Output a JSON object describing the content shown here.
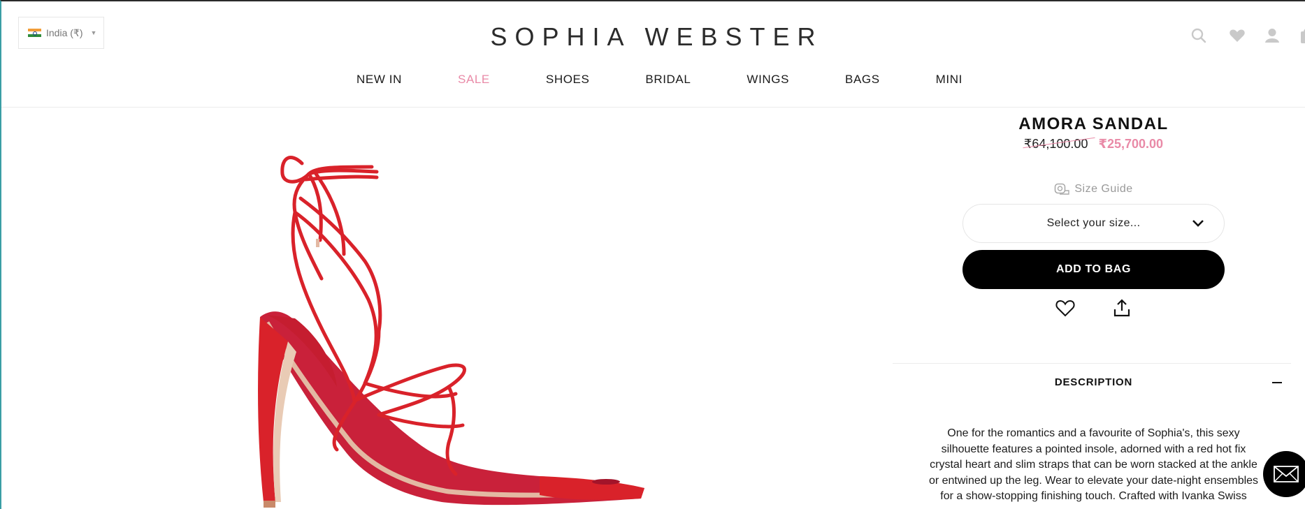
{
  "header": {
    "country": "India (₹)",
    "logo": "SOPHIA WEBSTER",
    "icons": [
      "search-icon",
      "heart-icon",
      "user-icon",
      "bag-icon"
    ]
  },
  "nav": {
    "items": [
      "NEW IN",
      "SALE",
      "SHOES",
      "BRIDAL",
      "WINGS",
      "BAGS",
      "MINI"
    ],
    "highlight_color": "#e98aa7"
  },
  "product": {
    "title": "AMORA SANDAL",
    "old_price": "₹64,100.00",
    "sale_price": "₹25,700.00",
    "size_guide": "Size Guide",
    "size_placeholder": "Select your size...",
    "add_to_bag": "ADD TO BAG",
    "image_subject": "red strappy lace-up stiletto sandal",
    "product_color": "#d9222a"
  },
  "description": {
    "heading": "DESCRIPTION",
    "text": "One for the romantics and a favourite of Sophia's, this sexy silhouette features a pointed insole, adorned with a red hot fix crystal heart and slim straps that can be worn stacked at the ankle or entwined up the leg. Wear to elevate your date-night ensembles for a show-stopping finishing touch. Crafted with Ivanka Swiss"
  },
  "chat": {
    "icon": "envelope-icon"
  }
}
